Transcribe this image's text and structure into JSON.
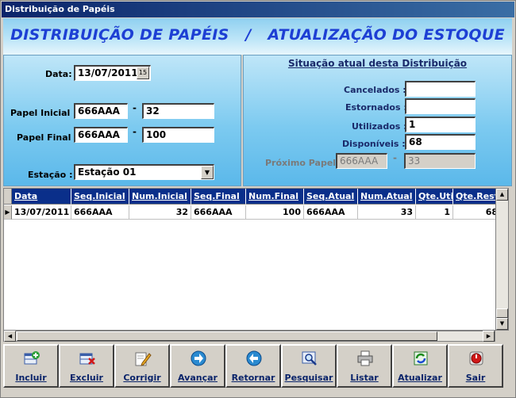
{
  "window": {
    "title": "Distribuição de Papéis"
  },
  "banner": {
    "title": "DISTRIBUIÇÃO DE PAPÉIS   /   ATUALIZAÇÃO DO ESTOQUE"
  },
  "form": {
    "data_label": "Data:",
    "data_value": "13/07/2011",
    "calendar_button_text": "15",
    "papel_inicial_label": "Papel Inicial :",
    "papel_inicial_seq": "666AAA",
    "papel_inicial_num": "32",
    "papel_final_label": "Papel Final :",
    "papel_final_seq": "666AAA",
    "papel_final_num": "100",
    "estacao_label": "Estação :",
    "estacao_value": "Estação 01",
    "dash": "-"
  },
  "situacao": {
    "title": "Situação atual desta Distribuição",
    "cancelados_label": "Cancelados :",
    "cancelados_value": "",
    "estornados_label": "Estornados :",
    "estornados_value": "",
    "utilizados_label": "Utilizados :",
    "utilizados_value": "1",
    "disponiveis_label": "Disponíveis :",
    "disponiveis_value": "68",
    "proximo_label": "Próximo Papel :",
    "proximo_seq": "666AAA",
    "proximo_num": "33"
  },
  "grid": {
    "columns": [
      "Data",
      "Seq.Inicial",
      "Num.Inicial",
      "Seq.Final",
      "Num.Final",
      "Seq.Atual",
      "Num.Atual",
      "Qte.Util",
      "Qte.Rest"
    ],
    "rows": [
      [
        "13/07/2011",
        "666AAA",
        "32",
        "666AAA",
        "100",
        "666AAA",
        "33",
        "1",
        "68"
      ]
    ]
  },
  "toolbar": {
    "buttons": [
      {
        "label": "Incluir",
        "icon": "add-record-icon"
      },
      {
        "label": "Excluir",
        "icon": "delete-record-icon"
      },
      {
        "label": "Corrigir",
        "icon": "edit-pencil-icon"
      },
      {
        "label": "Avançar",
        "icon": "arrow-right-icon"
      },
      {
        "label": "Retornar",
        "icon": "arrow-left-icon"
      },
      {
        "label": "Pesquisar",
        "icon": "search-icon"
      },
      {
        "label": "Listar",
        "icon": "printer-icon"
      },
      {
        "label": "Atualizar",
        "icon": "refresh-icon"
      },
      {
        "label": "Sair",
        "icon": "exit-icon"
      }
    ]
  }
}
